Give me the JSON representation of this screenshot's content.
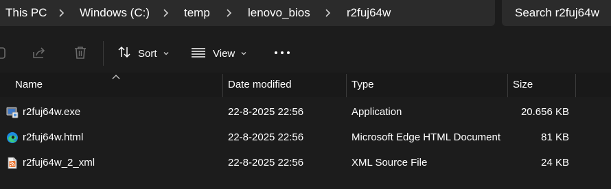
{
  "address_bar": {
    "crumbs": [
      "This PC",
      "Windows (C:)",
      "temp",
      "lenovo_bios",
      "r2fuj64w"
    ]
  },
  "search": {
    "placeholder": "Search r2fuj64w"
  },
  "command_bar": {
    "sort_label": "Sort",
    "view_label": "View",
    "more_icon": "more-icon"
  },
  "columns": {
    "name": "Name",
    "date_modified": "Date modified",
    "type": "Type",
    "size": "Size"
  },
  "files": [
    {
      "name": "r2fuj64w.exe",
      "date": "22-8-2025 22:56",
      "type": "Application",
      "size": "20.656 KB",
      "icon": "application-icon"
    },
    {
      "name": "r2fuj64w.html",
      "date": "22-8-2025 22:56",
      "type": "Microsoft Edge HTML Document",
      "size": "81 KB",
      "icon": "edge-icon"
    },
    {
      "name": "r2fuj64w_2_xml",
      "date": "22-8-2025 22:56",
      "type": "XML Source File",
      "size": "24 KB",
      "icon": "xml-file-icon"
    }
  ]
}
